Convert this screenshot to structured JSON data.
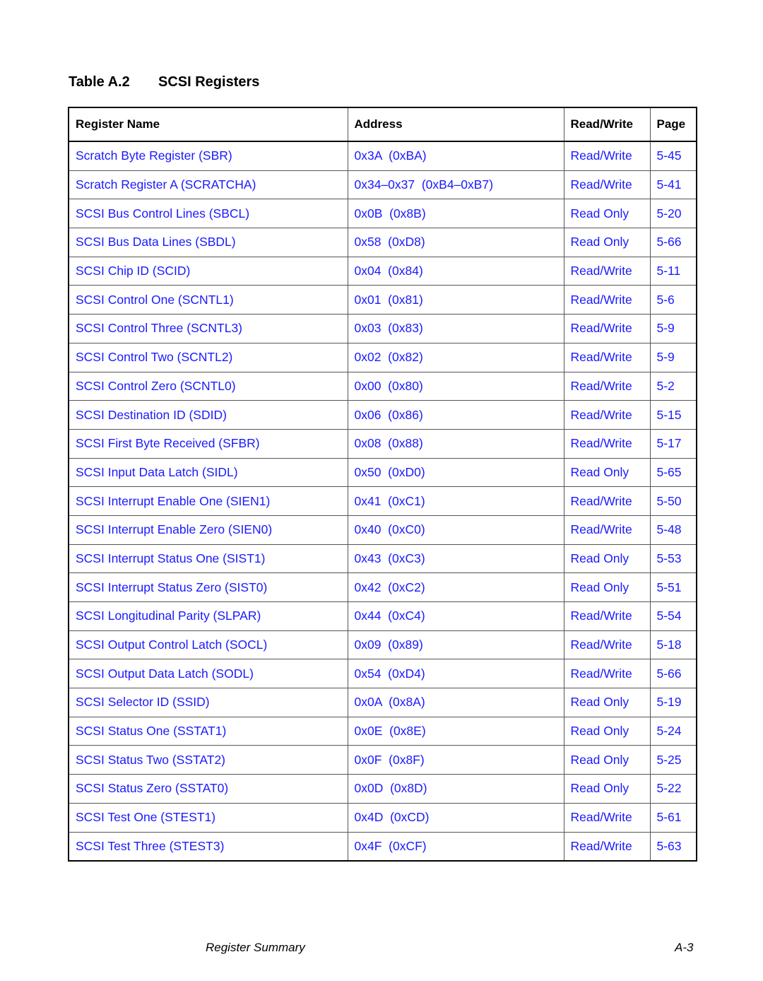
{
  "title": {
    "number": "Table A.2",
    "text": "SCSI Registers"
  },
  "table": {
    "headers": {
      "name": "Register Name",
      "address": "Address",
      "rw": "Read/Write",
      "page": "Page"
    },
    "rows": [
      {
        "name": "Scratch Byte Register (SBR)",
        "address": "0x3A  (0xBA)",
        "rw": "Read/Write",
        "page": "5-45"
      },
      {
        "name": "Scratch Register A (SCRATCHA)",
        "address": "0x34–0x37  (0xB4–0xB7)",
        "rw": "Read/Write",
        "page": "5-41"
      },
      {
        "name": "SCSI Bus Control Lines (SBCL)",
        "address": "0x0B  (0x8B)",
        "rw": "Read Only",
        "page": "5-20"
      },
      {
        "name": "SCSI Bus Data Lines (SBDL)",
        "address": "0x58  (0xD8)",
        "rw": "Read Only",
        "page": "5-66"
      },
      {
        "name": "SCSI Chip ID (SCID)",
        "address": "0x04  (0x84)",
        "rw": "Read/Write",
        "page": "5-11"
      },
      {
        "name": "SCSI Control One (SCNTL1)",
        "address": "0x01  (0x81)",
        "rw": "Read/Write",
        "page": "5-6"
      },
      {
        "name": "SCSI Control Three (SCNTL3)",
        "address": "0x03  (0x83)",
        "rw": "Read/Write",
        "page": "5-9"
      },
      {
        "name": "SCSI Control Two (SCNTL2)",
        "address": "0x02  (0x82)",
        "rw": "Read/Write",
        "page": "5-9"
      },
      {
        "name": "SCSI Control Zero (SCNTL0)",
        "address": "0x00  (0x80)",
        "rw": "Read/Write",
        "page": "5-2"
      },
      {
        "name": "SCSI Destination ID (SDID)",
        "address": "0x06  (0x86)",
        "rw": "Read/Write",
        "page": "5-15"
      },
      {
        "name": "SCSI First Byte Received (SFBR)",
        "address": "0x08  (0x88)",
        "rw": "Read/Write",
        "page": "5-17"
      },
      {
        "name": "SCSI Input Data Latch (SIDL)",
        "address": "0x50  (0xD0)",
        "rw": "Read Only",
        "page": "5-65"
      },
      {
        "name": "SCSI Interrupt Enable One (SIEN1)",
        "address": "0x41  (0xC1)",
        "rw": "Read/Write",
        "page": "5-50"
      },
      {
        "name": "SCSI Interrupt Enable Zero (SIEN0)",
        "address": "0x40  (0xC0)",
        "rw": "Read/Write",
        "page": "5-48"
      },
      {
        "name": "SCSI Interrupt Status One (SIST1)",
        "address": "0x43  (0xC3)",
        "rw": "Read Only",
        "page": "5-53"
      },
      {
        "name": "SCSI Interrupt Status Zero (SIST0)",
        "address": "0x42  (0xC2)",
        "rw": "Read Only",
        "page": "5-51"
      },
      {
        "name": "SCSI Longitudinal Parity (SLPAR)",
        "address": "0x44  (0xC4)",
        "rw": "Read/Write",
        "page": "5-54"
      },
      {
        "name": "SCSI Output Control Latch (SOCL)",
        "address": "0x09  (0x89)",
        "rw": "Read/Write",
        "page": "5-18"
      },
      {
        "name": "SCSI Output Data Latch (SODL)",
        "address": "0x54  (0xD4)",
        "rw": "Read/Write",
        "page": "5-66"
      },
      {
        "name": "SCSI Selector ID (SSID)",
        "address": "0x0A  (0x8A)",
        "rw": "Read Only",
        "page": "5-19"
      },
      {
        "name": "SCSI Status One (SSTAT1)",
        "address": "0x0E  (0x8E)",
        "rw": "Read Only",
        "page": "5-24"
      },
      {
        "name": "SCSI Status Two (SSTAT2)",
        "address": "0x0F  (0x8F)",
        "rw": "Read Only",
        "page": "5-25"
      },
      {
        "name": "SCSI Status Zero (SSTAT0)",
        "address": "0x0D  (0x8D)",
        "rw": "Read Only",
        "page": "5-22"
      },
      {
        "name": "SCSI Test One (STEST1)",
        "address": "0x4D  (0xCD)",
        "rw": "Read/Write",
        "page": "5-61"
      },
      {
        "name": "SCSI Test Three (STEST3)",
        "address": "0x4F  (0xCF)",
        "rw": "Read/Write",
        "page": "5-63"
      }
    ]
  },
  "footer": {
    "section": "Register Summary",
    "page": "A-3"
  },
  "colors": {
    "link": "#1a1aff",
    "text": "#000000"
  }
}
